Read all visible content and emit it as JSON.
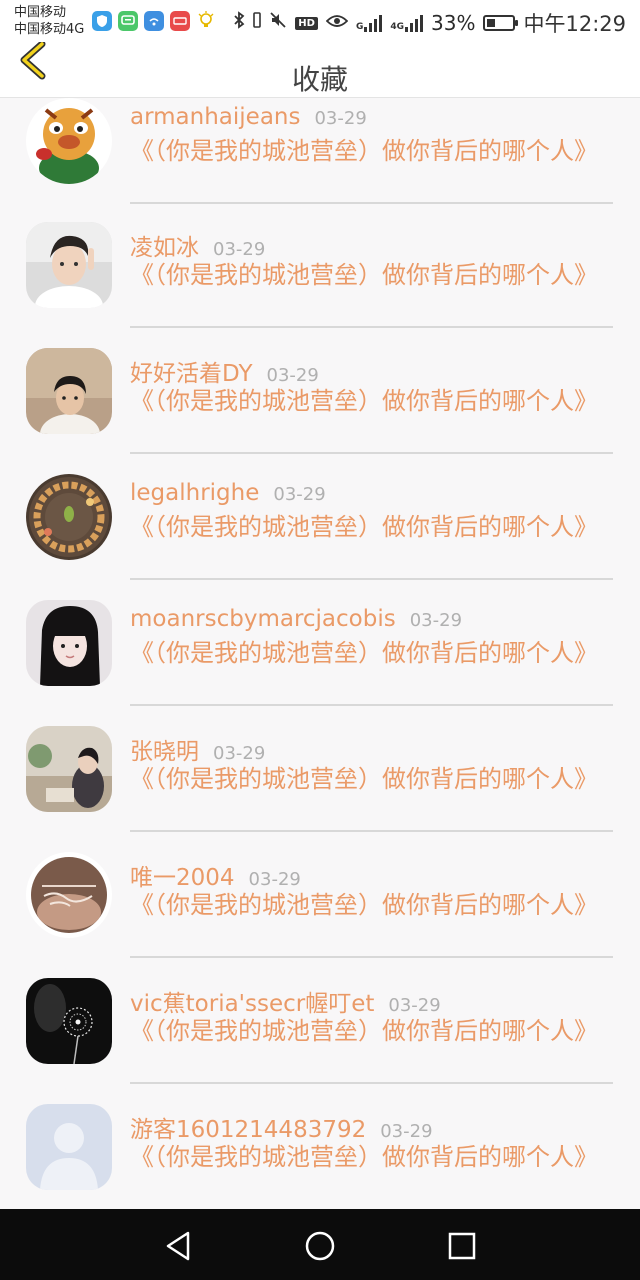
{
  "status_bar": {
    "carrier_line1": "中国移动",
    "carrier_line2": "中国移动4G",
    "hd_label": "HD",
    "net_label_1": "G",
    "net_label_2": "4G",
    "battery_pct": "33%",
    "battery_level": 0.33,
    "time": "中午12:29"
  },
  "header": {
    "title": "收藏"
  },
  "colors": {
    "accent": "#ea9a67",
    "date": "#b0b0b0"
  },
  "items": [
    {
      "name": "armanhaijeans",
      "date": "03-29",
      "text": "《（你是我的城池营垒）做你背后的哪个人》",
      "avatar": "cartoon-avatar"
    },
    {
      "name": "凌如冰",
      "date": "03-29",
      "text": "《（你是我的城池营垒）做你背后的哪个人》",
      "avatar": "photo-avatar"
    },
    {
      "name": "好好活着DY",
      "date": "03-29",
      "text": "《（你是我的城池营垒）做你背后的哪个人》",
      "avatar": "photo-avatar"
    },
    {
      "name": "legalhrighe",
      "date": "03-29",
      "text": "《（你是我的城池营垒）做你背后的哪个人》",
      "avatar": "bowl-avatar"
    },
    {
      "name": "moanrscbymarcjacobis",
      "date": "03-29",
      "text": "《（你是我的城池营垒）做你背后的哪个人》",
      "avatar": "photo-avatar"
    },
    {
      "name": "张晓明",
      "date": "03-29",
      "text": "《（你是我的城池营垒）做你背后的哪个人》",
      "avatar": "photo-avatar"
    },
    {
      "name": "唯一2004",
      "date": "03-29",
      "text": "《（你是我的城池营垒）做你背后的哪个人》",
      "avatar": "text-avatar"
    },
    {
      "name": "vic蕉toria'ssecr幄叮et",
      "date": "03-29",
      "text": "《（你是我的城池营垒）做你背后的哪个人》",
      "avatar": "dandelion-avatar"
    },
    {
      "name": "游客1601214483792",
      "date": "03-29",
      "text": "《（你是我的城池营垒）做你背后的哪个人》",
      "avatar": "default-avatar"
    }
  ]
}
